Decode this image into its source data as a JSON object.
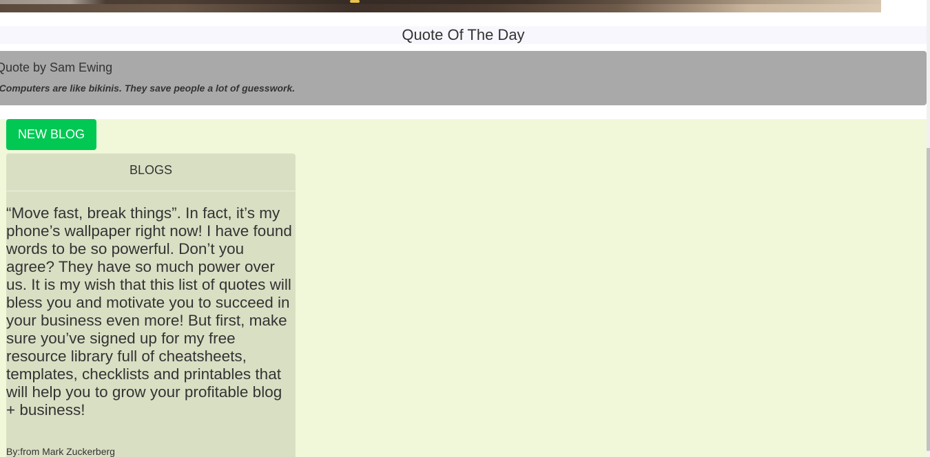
{
  "quote_of_the_day": {
    "title": "Quote Of The Day",
    "author_line": "Quote by Sam Ewing",
    "text": "-Computers are like bikinis. They save people a lot of guesswork."
  },
  "blogs": {
    "new_blog_label": "NEW BLOG",
    "header": "BLOGS",
    "items": [
      {
        "body": "“Move fast, break things”. In fact, it’s my phone’s wallpaper right now! I have found words to be so powerful. Don’t you agree? They have so much power over us. It is my wish that this list of quotes will bless you and motivate you to succeed in your business even more! But first, make sure you’ve signed up for my free resource library full of cheatsheets, templates, checklists and printables that will help you to grow your profitable blog + business!",
        "author": "By:from Mark Zuckerberg"
      }
    ]
  },
  "colors": {
    "new_blog_button": "#00c853",
    "quote_card": "#a9a9a9",
    "blog_area": "#f1f8da",
    "blogs_panel": "#d9dfc3"
  }
}
